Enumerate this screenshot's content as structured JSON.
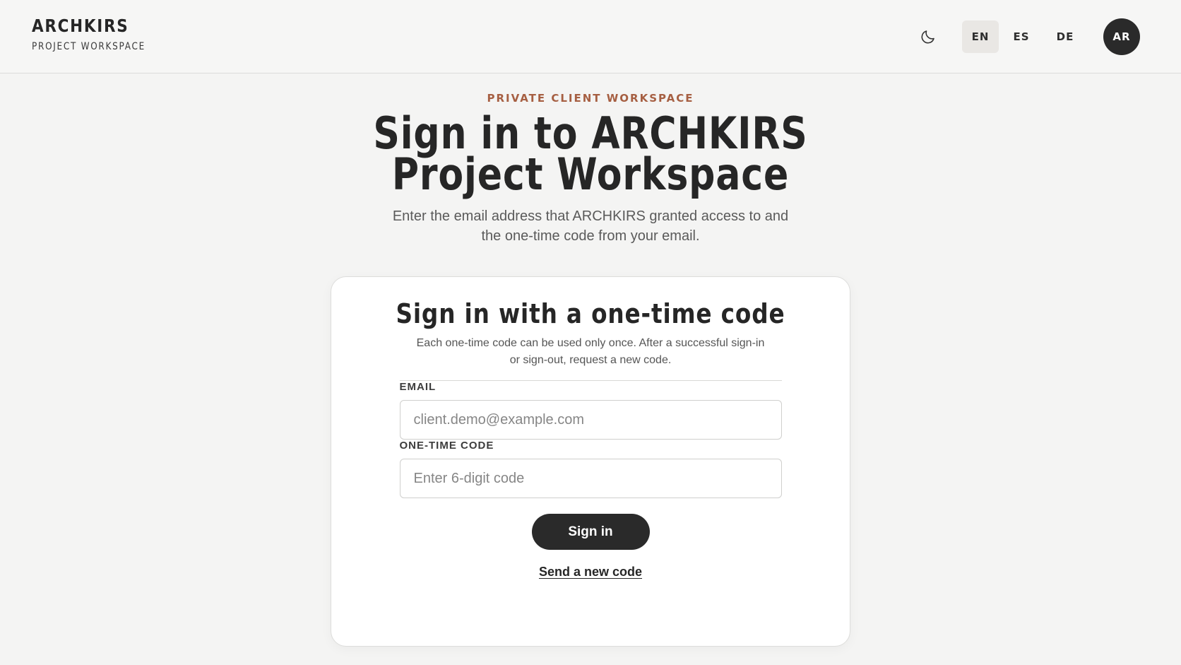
{
  "header": {
    "brand_title": "ARCHKIRS",
    "brand_subtitle": "PROJECT WORKSPACE",
    "theme_icon": "moon-icon",
    "languages": [
      {
        "code": "EN",
        "active": true
      },
      {
        "code": "ES",
        "active": false
      },
      {
        "code": "DE",
        "active": false
      }
    ],
    "avatar_initials": "AR"
  },
  "hero": {
    "eyebrow": "PRIVATE CLIENT WORKSPACE",
    "headline_line1": "Sign in to ARCHKIRS",
    "headline_line2": "Project Workspace",
    "intro_line1": "Enter the email address that ARCHKIRS granted access to and",
    "intro_line2": "the one-time code from your email."
  },
  "card": {
    "title": "Sign in with a one-time code",
    "note_line1": "Each one-time code can be used only once. After a successful sign-in",
    "note_line2": "or sign-out, request a new code.",
    "email": {
      "label": "EMAIL",
      "value": "",
      "placeholder": "client.demo@example.com"
    },
    "code": {
      "label": "ONE-TIME CODE",
      "value": "",
      "placeholder": "Enter 6-digit code"
    },
    "signin_label": "Sign in",
    "resend_label": "Send a new code"
  },
  "colors": {
    "background": "#f4f4f3",
    "accent_eyebrow": "#a65f42",
    "dark": "#2a2a2a",
    "active_language_bg": "#e9e7e4"
  }
}
